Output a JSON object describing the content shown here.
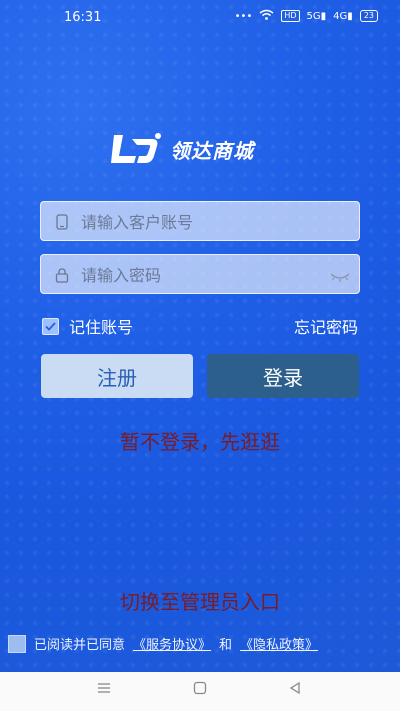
{
  "status_bar": {
    "time": "16:31",
    "hd_label": "HD",
    "signal_1": "5G",
    "signal_2": "4G",
    "battery": "23"
  },
  "logo": {
    "text": "领达商城"
  },
  "account_field": {
    "placeholder": "请输入客户账号"
  },
  "password_field": {
    "placeholder": "请输入密码"
  },
  "remember": {
    "label": "记住账号",
    "checked": true
  },
  "forgot_password": "忘记密码",
  "buttons": {
    "register": "注册",
    "login": "登录"
  },
  "guest_link": "暂不登录，先逛逛",
  "admin_link": "切换至管理员入口",
  "agreement": {
    "prefix": "已阅读并已同意",
    "service": "《服务协议》",
    "and": "和",
    "privacy": "《隐私政策》"
  },
  "colors": {
    "background": "#1f5fe6",
    "login_button": "#2c5f8c",
    "register_button": "#c9dcf4",
    "link_red": "#7a1b25"
  },
  "icons": [
    "wifi-icon",
    "phone-icon",
    "lock-icon",
    "eye-closed-icon",
    "check-icon",
    "menu-icon",
    "home-icon",
    "back-icon"
  ]
}
